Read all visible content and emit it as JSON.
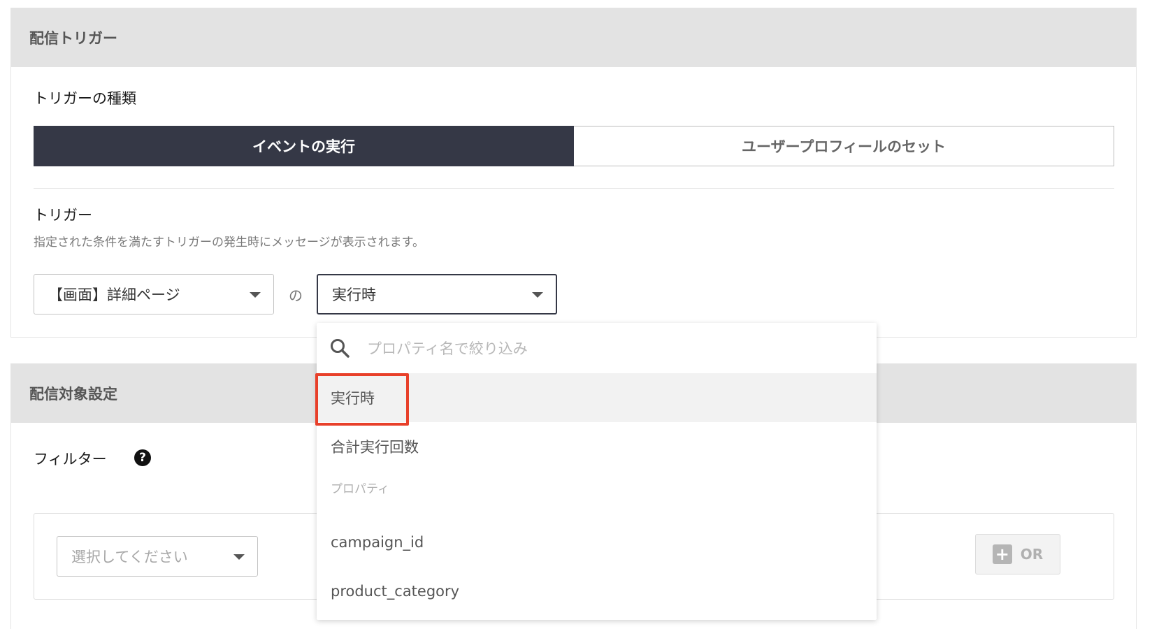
{
  "delivery_trigger": {
    "header": "配信トリガー",
    "trigger_type_label": "トリガーの種類",
    "segments": [
      {
        "label": "イベントの実行",
        "selected": true
      },
      {
        "label": "ユーザープロフィールのセット",
        "selected": false
      }
    ],
    "trigger_label": "トリガー",
    "trigger_helper": "指定された条件を満たすトリガーの発生時にメッセージが表示されます。",
    "event_select_value": "【画面】詳細ページ",
    "connector_text": "の",
    "timing_select_value": "実行時"
  },
  "dropdown": {
    "search_placeholder": "プロパティ名で絞り込み",
    "items": [
      {
        "label": "実行時",
        "hovered": true
      },
      {
        "label": "合計実行回数",
        "hovered": false
      }
    ],
    "group_label": "プロパティ",
    "property_items": [
      {
        "label": "campaign_id"
      },
      {
        "label": "product_category"
      }
    ]
  },
  "delivery_target": {
    "header": "配信対象設定",
    "filter_label": "フィルター",
    "help_icon": "?",
    "filter_select_placeholder": "選択してください",
    "or_button_label": "OR",
    "or_button_icon": "+"
  },
  "colors": {
    "segment_active_bg": "#353846",
    "highlight_border": "#e8402a",
    "header_bg": "#e3e3e3"
  }
}
